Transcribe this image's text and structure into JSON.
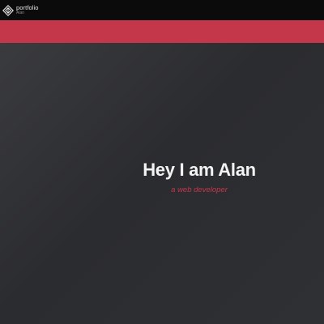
{
  "header": {
    "brand": {
      "title": "portfolio",
      "subtitle": "Alan",
      "icon": "logo-icon"
    }
  },
  "hero": {
    "title": "Hey I am Alan",
    "subtitle": "a web developer"
  },
  "colors": {
    "accent": "#c4364a",
    "topbar": "#0b0b0c",
    "background": "#2a2b2e",
    "title_text": "#f3f3f3"
  }
}
